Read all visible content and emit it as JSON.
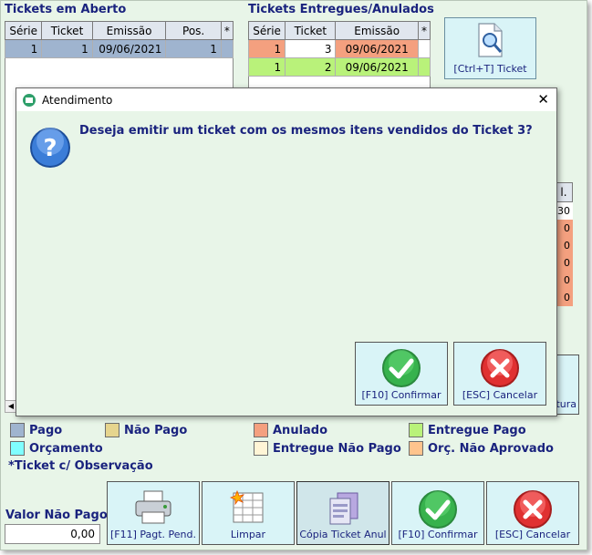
{
  "open_tickets": {
    "title": "Tickets em Aberto",
    "columns": [
      "Série",
      "Ticket",
      "Emissão",
      "Pos.",
      "*"
    ],
    "rows": [
      [
        "1",
        "1",
        "09/06/2021",
        "1",
        ""
      ]
    ]
  },
  "delivered_tickets": {
    "title": "Tickets Entregues/Anulados",
    "columns": [
      "Série",
      "Ticket",
      "Emissão",
      "*"
    ],
    "rows": [
      {
        "serie": "1",
        "ticket": "3",
        "emissao": "09/06/2021",
        "status": "anulado"
      },
      {
        "serie": "1",
        "ticket": "2",
        "emissao": "09/06/2021",
        "status": "entregue_pago"
      }
    ]
  },
  "ticket_button": {
    "label": "[Ctrl+T] Ticket",
    "icon": "magnifier-document-icon"
  },
  "partial_right_column": {
    "header": "l.",
    "values": [
      "30",
      "0",
      "0",
      "0",
      "0",
      "0"
    ],
    "button_label": "tura"
  },
  "legend": {
    "pago": {
      "label": "Pago",
      "color": "#9fb4cf"
    },
    "nao_pago": {
      "label": "Não Pago",
      "color": "#e6d58e"
    },
    "orcamento": {
      "label": "Orçamento",
      "color": "#7fffff"
    },
    "anulado": {
      "label": "Anulado",
      "color": "#f4a07f"
    },
    "entregue_pago": {
      "label": "Entregue Pago",
      "color": "#b9f27a"
    },
    "entregue_nao_pago": {
      "label": "Entregue Não Pago",
      "color": "#fff5d6"
    },
    "orc_nao_aprovado": {
      "label": "Orç. Não Aprovado",
      "color": "#ffc48d"
    },
    "observacao": "*Ticket c/ Observação"
  },
  "valor_nao_pago": {
    "label": "Valor Não Pago",
    "value": "0,00"
  },
  "bottom_buttons": {
    "pagt_pend": "[F11] Pagt. Pend.",
    "limpar": "Limpar",
    "copia": "Cópia Ticket Anul",
    "confirmar": "[F10] Confirmar",
    "cancelar": "[ESC] Cancelar"
  },
  "dialog": {
    "title": "Atendimento",
    "message": "Deseja emitir um ticket com os mesmos itens vendidos do Ticket 3?",
    "confirm_label": "[F10] Confirmar",
    "cancel_label": "[ESC] Cancelar",
    "close_glyph": "✕"
  }
}
